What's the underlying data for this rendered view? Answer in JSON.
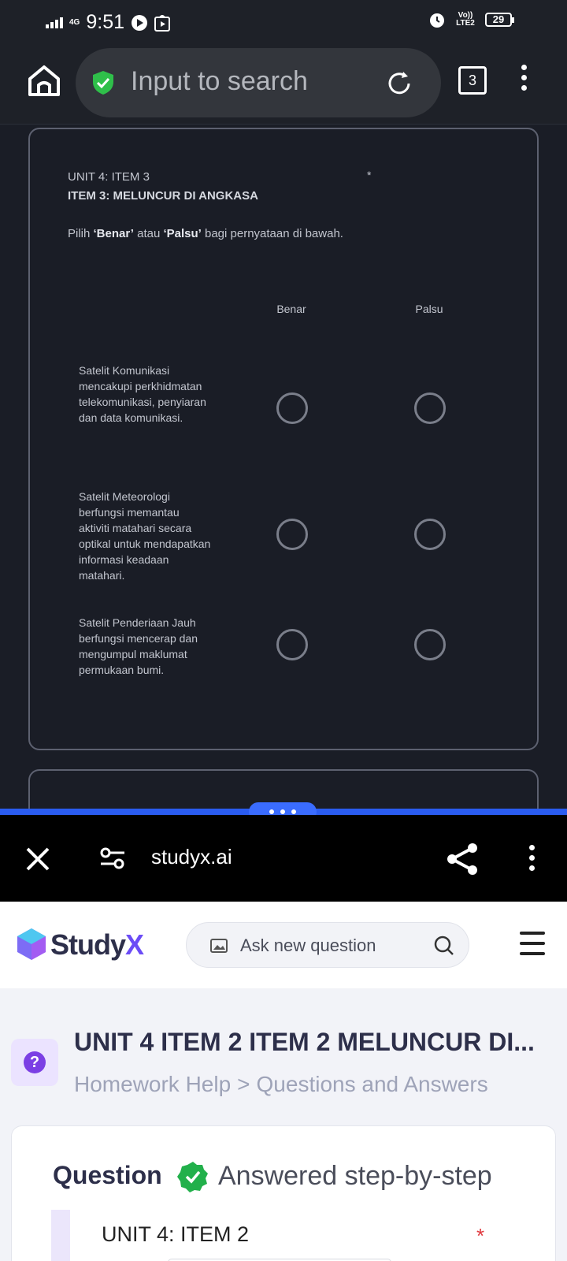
{
  "status_bar": {
    "network": "4G",
    "time": "9:51",
    "volte": "Vo)) LTE2",
    "battery": "29"
  },
  "browser": {
    "search_placeholder": "Input to search",
    "tab_count": "3"
  },
  "form": {
    "label": "UNIT 4: ITEM 3",
    "title": "ITEM 3: MELUNCUR DI ANGKASA",
    "required_mark": "*",
    "instruction_pre": "Pilih ",
    "instruction_true": "‘Benar’",
    "instruction_mid": " atau ",
    "instruction_false": "‘Palsu’",
    "instruction_post": " bagi pernyataan di bawah.",
    "columns": [
      "Benar",
      "Palsu"
    ],
    "rows": [
      "Satelit Komunikasi mencakupi perkhidmatan telekomunikasi, penyiaran dan data komunikasi.",
      "Satelit Meteorologi berfungsi memantau aktiviti matahari secara optikal untuk mendapatkan informasi keadaan matahari.",
      "Satelit Penderiaan Jauh berfungsi mencerap dan mengumpul maklumat permukaan bumi."
    ]
  },
  "mini_browser": {
    "url": "studyx.ai"
  },
  "studyx": {
    "logo_main": "Study",
    "logo_x": "X",
    "search_placeholder": "Ask new question",
    "page_title": "UNIT 4 ITEM 2 ITEM 2 MELUNCUR DI...",
    "breadcrumb": [
      "Homework Help",
      ">",
      "Questions and Answers"
    ],
    "question_label": "Question",
    "answered_label": "Answered step-by-step",
    "quote_text": "UNIT 4: ITEM 2",
    "quote_required": "*"
  },
  "colors": {
    "accent_blue": "#2a5cf0",
    "studyx_purple": "#6b4cf6",
    "check_green": "#22b04b"
  }
}
